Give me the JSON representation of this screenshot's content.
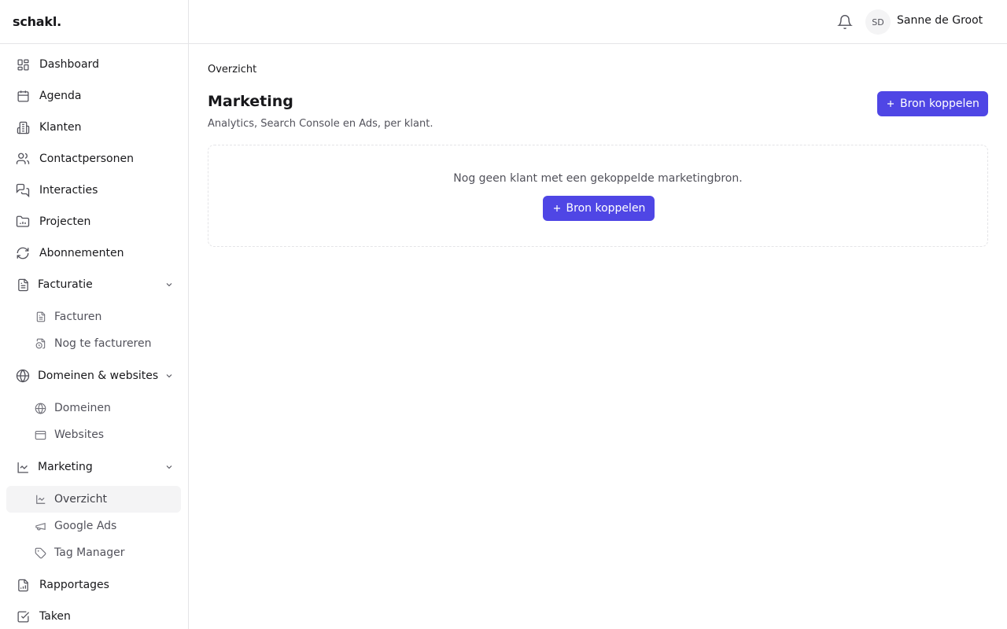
{
  "brand": {
    "name": "schakl."
  },
  "header": {
    "notifications_icon": "bell-icon",
    "avatar_initials": "SD",
    "user_name": "Sanne de Groot"
  },
  "sidebar": {
    "items": [
      {
        "label": "Dashboard",
        "icon": "dashboard-icon"
      },
      {
        "label": "Agenda",
        "icon": "calendar-icon"
      },
      {
        "label": "Klanten",
        "icon": "building-icon"
      },
      {
        "label": "Contactpersonen",
        "icon": "users-icon"
      },
      {
        "label": "Interacties",
        "icon": "chat-icon"
      },
      {
        "label": "Projecten",
        "icon": "folder-chart-icon"
      },
      {
        "label": "Abonnementen",
        "icon": "refresh-icon"
      }
    ],
    "groups": [
      {
        "label": "Facturatie",
        "icon": "file-icon",
        "children": [
          {
            "label": "Facturen",
            "icon": "file-icon"
          },
          {
            "label": "Nog te factureren",
            "icon": "file-clock-icon"
          }
        ]
      },
      {
        "label": "Domeinen & websites",
        "icon": "globe-icon",
        "children": [
          {
            "label": "Domeinen",
            "icon": "globe-icon"
          },
          {
            "label": "Websites",
            "icon": "browser-icon"
          }
        ]
      },
      {
        "label": "Marketing",
        "icon": "line-chart-icon",
        "children": [
          {
            "label": "Overzicht",
            "icon": "line-chart-icon",
            "active": true
          },
          {
            "label": "Google Ads",
            "icon": "megaphone-icon"
          },
          {
            "label": "Tag Manager",
            "icon": "tag-icon"
          }
        ]
      }
    ],
    "bottom_items": [
      {
        "label": "Rapportages",
        "icon": "file-chart-icon"
      },
      {
        "label": "Taken",
        "icon": "checkbox-icon"
      }
    ]
  },
  "main": {
    "breadcrumb": "Overzicht",
    "title": "Marketing",
    "subtitle": "Analytics, Search Console en Ads, per klant.",
    "primary_button": "Bron koppelen",
    "empty_state": {
      "message": "Nog geen klant met een gekoppelde marketingbron.",
      "button": "Bron koppelen"
    }
  },
  "colors": {
    "accent": "#4f46e5",
    "border": "#e4e4e7",
    "active_bg": "#f4f4f5"
  }
}
